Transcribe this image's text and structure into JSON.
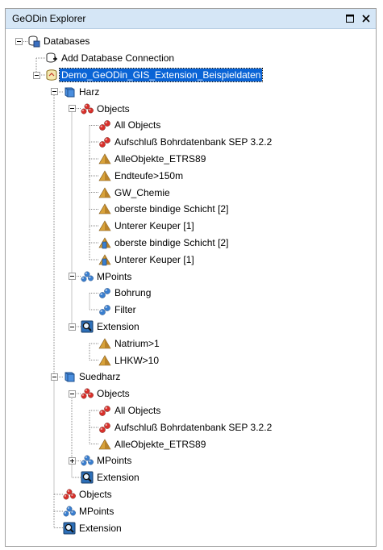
{
  "window": {
    "title": "GeODin Explorer"
  },
  "tree": [
    {
      "label": "Databases",
      "icon": "database-stack-icon",
      "level": 0,
      "expander": "minus"
    },
    {
      "label": "Add Database Connection",
      "icon": "add-connection-icon",
      "level": 1,
      "expander": "none"
    },
    {
      "label": "Demo_GeODin_GIS_Extension_Beispieldaten",
      "icon": "database-project-icon",
      "level": 1,
      "expander": "minus",
      "selected": true
    },
    {
      "label": "Harz",
      "icon": "project-cylinder-icon",
      "level": 2,
      "expander": "minus"
    },
    {
      "label": "Objects",
      "icon": "objects-red-icon",
      "level": 3,
      "expander": "minus"
    },
    {
      "label": "All Objects",
      "icon": "red-object-icon",
      "level": 4,
      "expander": "none"
    },
    {
      "label": "Aufschluß Bohrdatenbank SEP 3.2.2",
      "icon": "red-object-icon",
      "level": 4,
      "expander": "none"
    },
    {
      "label": "AlleObjekte_ETRS89",
      "icon": "query-triangle-icon",
      "level": 4,
      "expander": "none"
    },
    {
      "label": "Endteufe>150m",
      "icon": "query-triangle-icon",
      "level": 4,
      "expander": "none"
    },
    {
      "label": "GW_Chemie",
      "icon": "query-triangle-icon",
      "level": 4,
      "expander": "none"
    },
    {
      "label": "oberste bindige Schicht [2]",
      "icon": "query-triangle-icon",
      "level": 4,
      "expander": "none"
    },
    {
      "label": "Unterer Keuper [1]",
      "icon": "query-triangle-icon",
      "level": 4,
      "expander": "none"
    },
    {
      "label": "oberste bindige Schicht [2]",
      "icon": "query-triangle-layer-icon",
      "level": 4,
      "expander": "none"
    },
    {
      "label": "Unterer Keuper [1]",
      "icon": "query-triangle-layer-icon",
      "level": 4,
      "expander": "none"
    },
    {
      "label": "MPoints",
      "icon": "mpoints-blue-icon",
      "level": 3,
      "expander": "minus"
    },
    {
      "label": "Bohrung",
      "icon": "blue-object-icon",
      "level": 4,
      "expander": "none"
    },
    {
      "label": "Filter",
      "icon": "blue-object-icon",
      "level": 4,
      "expander": "none"
    },
    {
      "label": "Extension",
      "icon": "extension-magnifier-icon",
      "level": 3,
      "expander": "minus"
    },
    {
      "label": "Natrium>1",
      "icon": "query-triangle-icon",
      "level": 4,
      "expander": "none"
    },
    {
      "label": "LHKW>10",
      "icon": "query-triangle-icon",
      "level": 4,
      "expander": "none"
    },
    {
      "label": "Suedharz",
      "icon": "project-cylinder-icon",
      "level": 2,
      "expander": "minus"
    },
    {
      "label": "Objects",
      "icon": "objects-red-icon",
      "level": 3,
      "expander": "minus"
    },
    {
      "label": "All Objects",
      "icon": "red-object-icon",
      "level": 4,
      "expander": "none"
    },
    {
      "label": "Aufschluß Bohrdatenbank SEP 3.2.2",
      "icon": "red-object-icon",
      "level": 4,
      "expander": "none"
    },
    {
      "label": "AlleObjekte_ETRS89",
      "icon": "query-triangle-icon",
      "level": 4,
      "expander": "none"
    },
    {
      "label": "MPoints",
      "icon": "mpoints-blue-icon",
      "level": 3,
      "expander": "plus"
    },
    {
      "label": "Extension",
      "icon": "extension-magnifier-icon",
      "level": 3,
      "expander": "none"
    },
    {
      "label": "Objects",
      "icon": "objects-red-icon",
      "level": 2,
      "expander": "none"
    },
    {
      "label": "MPoints",
      "icon": "mpoints-blue-icon",
      "level": 2,
      "expander": "none"
    },
    {
      "label": "Extension",
      "icon": "extension-magnifier-icon",
      "level": 2,
      "expander": "none"
    }
  ],
  "colors": {
    "titlebar": "#d5e6f6",
    "selection": "#0a64d6",
    "red_object": "#d9302b",
    "blue_object": "#3a7fd0",
    "query_triangle": "#d8a23a"
  }
}
